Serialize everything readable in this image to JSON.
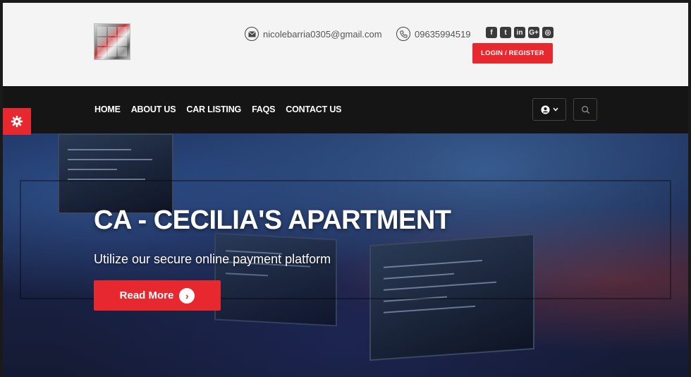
{
  "header": {
    "email": "nicolebarria0305@gmail.com",
    "phone": "09635994519",
    "login_label": "LOGIN / REGISTER",
    "socials": [
      "facebook-icon",
      "twitter-icon",
      "linkedin-icon",
      "google-plus-icon",
      "instagram-icon"
    ],
    "social_glyphs": [
      "f",
      "t",
      "in",
      "G+",
      "◎"
    ]
  },
  "nav": {
    "items": [
      "HOME",
      "ABOUT US",
      "CAR LISTING",
      "FAQS",
      "CONTACT US"
    ]
  },
  "hero": {
    "title": "CA - CECILIA'S APARTMENT",
    "subtitle": "Utilize our secure online payment platform",
    "cta_label": "Read More"
  },
  "colors": {
    "accent": "#e8282f",
    "nav_bg": "#151515",
    "header_bg": "#f4f4f4"
  }
}
